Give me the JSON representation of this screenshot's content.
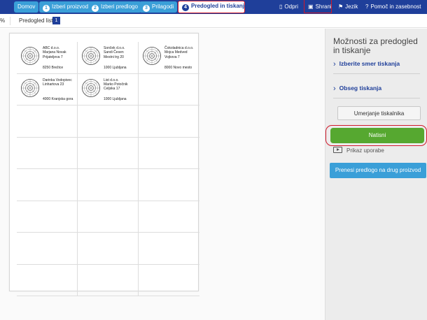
{
  "steps": [
    {
      "label": "Domov",
      "num": ""
    },
    {
      "label": "Izberi proizvod",
      "num": "1"
    },
    {
      "label": "Izberi predlogo",
      "num": "2"
    },
    {
      "label": "Prilagodi",
      "num": "3"
    },
    {
      "label": "Predogled in tiskanje",
      "num": "4"
    }
  ],
  "toplinks": {
    "open": "Odpri",
    "save": "Shrani",
    "language": "Jezik",
    "help": "Pomoč in zasebnost"
  },
  "subbar": {
    "zoom": "%",
    "preview_label": "Predogled lista",
    "page": "1"
  },
  "labels": [
    {
      "l1": "ABC d.o.o.",
      "l2": "Marjana Novak",
      "l3": "Prijateljeva 7",
      "l4": "8250 Brežice"
    },
    {
      "l1": "Sonček d.o.o.",
      "l2": "Sandi Česen",
      "l3": "Mestni trg 20",
      "l4": "1000 Ljubljana"
    },
    {
      "l1": "Čokoladnica d.o.o.",
      "l2": "Mojca Medved",
      "l3": "Vojkova 7",
      "l4": "8000 Novo mesto"
    },
    {
      "l1": "Darinka Vodopivec",
      "l2": "Linhartova 23",
      "l3": "",
      "l4": "4000 Kranjska gora"
    },
    {
      "l1": "List d.o.o.",
      "l2": "Marko Potočnik",
      "l3": "Celjska 17",
      "l4": "1000 Ljubljana"
    }
  ],
  "panel": {
    "title": "Možnosti za predogled in tiskanje",
    "direction": "Izberite smer tiskanja",
    "range": "Obseg tiskanja",
    "calibrate": "Umerjanje tiskalnika",
    "print": "Natisni",
    "demo": "Prikaz uporabe",
    "transfer": "Prenesi predlogo na drug proizvod"
  },
  "colors": {
    "topbar": "#1f3f9a",
    "step": "#3a9fd8",
    "print": "#56a830",
    "highlight": "#d0182a"
  }
}
